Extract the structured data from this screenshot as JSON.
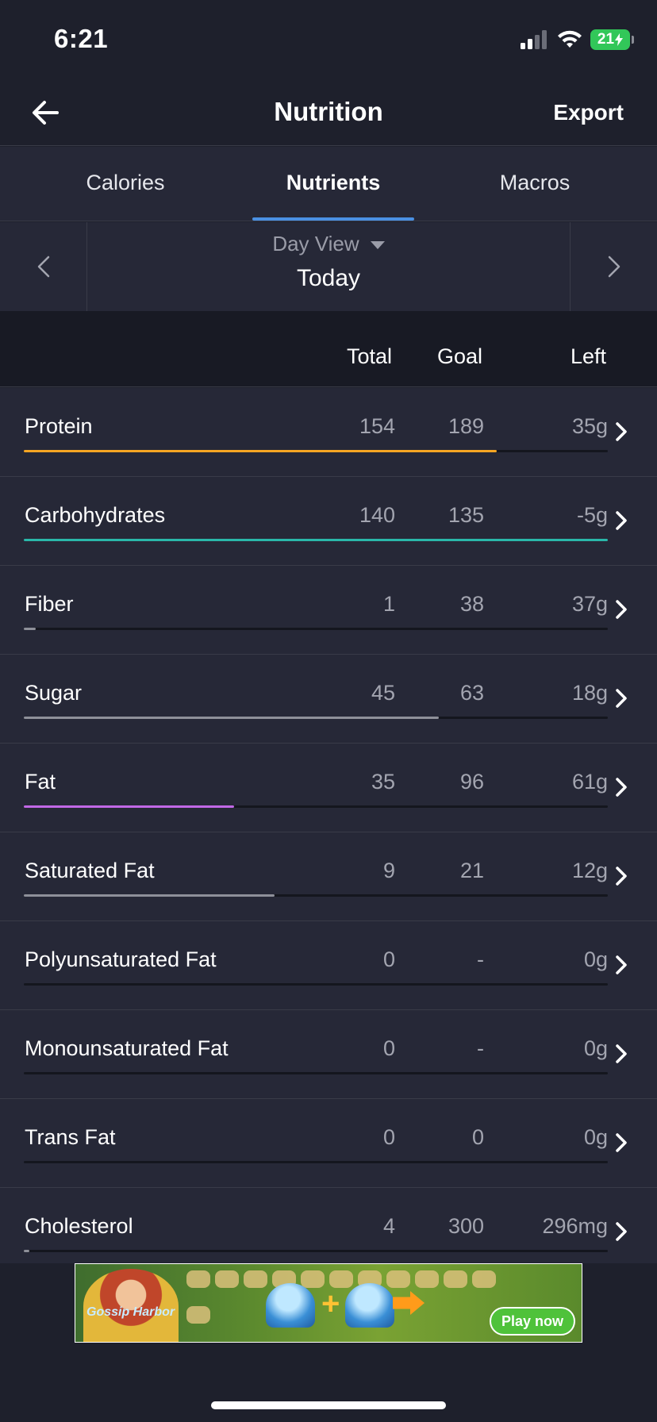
{
  "status_bar": {
    "time": "6:21",
    "battery": "21"
  },
  "nav": {
    "title": "Nutrition",
    "export_label": "Export"
  },
  "tabs": [
    {
      "label": "Calories",
      "active": false
    },
    {
      "label": "Nutrients",
      "active": true
    },
    {
      "label": "Macros",
      "active": false
    }
  ],
  "date_bar": {
    "view_label": "Day View",
    "date": "Today"
  },
  "columns": {
    "total": "Total",
    "goal": "Goal",
    "left": "Left"
  },
  "colors": {
    "accent": "#4a90e2",
    "protein": "#f5a623",
    "carbohydrates": "#2ab7a9",
    "fat": "#c168e6",
    "neutral_bar": "#8e9099"
  },
  "nutrients": [
    {
      "name": "Protein",
      "total": "154",
      "goal": "189",
      "left": "35g",
      "progress": 0.81,
      "color": "#f5a623"
    },
    {
      "name": "Carbohydrates",
      "total": "140",
      "goal": "135",
      "left": "-5g",
      "progress": 1.0,
      "color": "#2ab7a9"
    },
    {
      "name": "Fiber",
      "total": "1",
      "goal": "38",
      "left": "37g",
      "progress": 0.02,
      "color": "#8e9099"
    },
    {
      "name": "Sugar",
      "total": "45",
      "goal": "63",
      "left": "18g",
      "progress": 0.71,
      "color": "#8e9099"
    },
    {
      "name": "Fat",
      "total": "35",
      "goal": "96",
      "left": "61g",
      "progress": 0.36,
      "color": "#c168e6"
    },
    {
      "name": "Saturated Fat",
      "total": "9",
      "goal": "21",
      "left": "12g",
      "progress": 0.43,
      "color": "#8e9099"
    },
    {
      "name": "Polyunsaturated Fat",
      "total": "0",
      "goal": "-",
      "left": "0g",
      "progress": 0,
      "color": "#8e9099"
    },
    {
      "name": "Monounsaturated Fat",
      "total": "0",
      "goal": "-",
      "left": "0g",
      "progress": 0,
      "color": "#8e9099"
    },
    {
      "name": "Trans Fat",
      "total": "0",
      "goal": "0",
      "left": "0g",
      "progress": 0,
      "color": "#8e9099"
    },
    {
      "name": "Cholesterol",
      "total": "4",
      "goal": "300",
      "left": "296mg",
      "progress": 0.01,
      "color": "#8e9099"
    }
  ],
  "ad": {
    "cta_label": "Play now",
    "logo_text": "Gossip Harbor"
  }
}
